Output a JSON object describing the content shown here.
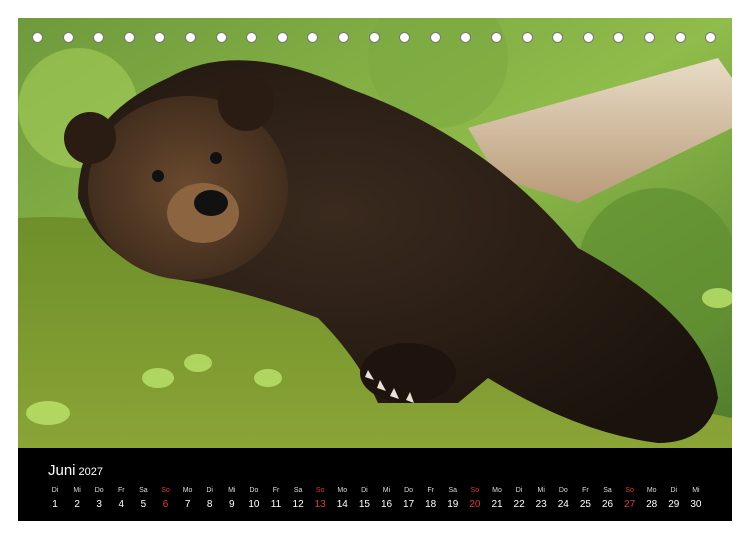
{
  "calendar": {
    "month": "Juni",
    "year": "2027",
    "colors": {
      "weekday": "#ffffff",
      "sunday": "#e23a2e",
      "strip": "#000000"
    },
    "days": [
      {
        "wd": "Di",
        "n": "1",
        "sun": false
      },
      {
        "wd": "Mi",
        "n": "2",
        "sun": false
      },
      {
        "wd": "Do",
        "n": "3",
        "sun": false
      },
      {
        "wd": "Fr",
        "n": "4",
        "sun": false
      },
      {
        "wd": "Sa",
        "n": "5",
        "sun": false
      },
      {
        "wd": "So",
        "n": "6",
        "sun": true
      },
      {
        "wd": "Mo",
        "n": "7",
        "sun": false
      },
      {
        "wd": "Di",
        "n": "8",
        "sun": false
      },
      {
        "wd": "Mi",
        "n": "9",
        "sun": false
      },
      {
        "wd": "Do",
        "n": "10",
        "sun": false
      },
      {
        "wd": "Fr",
        "n": "11",
        "sun": false
      },
      {
        "wd": "Sa",
        "n": "12",
        "sun": false
      },
      {
        "wd": "So",
        "n": "13",
        "sun": true
      },
      {
        "wd": "Mo",
        "n": "14",
        "sun": false
      },
      {
        "wd": "Di",
        "n": "15",
        "sun": false
      },
      {
        "wd": "Mi",
        "n": "16",
        "sun": false
      },
      {
        "wd": "Do",
        "n": "17",
        "sun": false
      },
      {
        "wd": "Fr",
        "n": "18",
        "sun": false
      },
      {
        "wd": "Sa",
        "n": "19",
        "sun": false
      },
      {
        "wd": "So",
        "n": "20",
        "sun": true
      },
      {
        "wd": "Mo",
        "n": "21",
        "sun": false
      },
      {
        "wd": "Di",
        "n": "22",
        "sun": false
      },
      {
        "wd": "Mi",
        "n": "23",
        "sun": false
      },
      {
        "wd": "Do",
        "n": "24",
        "sun": false
      },
      {
        "wd": "Fr",
        "n": "25",
        "sun": false
      },
      {
        "wd": "Sa",
        "n": "26",
        "sun": false
      },
      {
        "wd": "So",
        "n": "27",
        "sun": true
      },
      {
        "wd": "Mo",
        "n": "28",
        "sun": false
      },
      {
        "wd": "Di",
        "n": "29",
        "sun": false
      },
      {
        "wd": "Mi",
        "n": "30",
        "sun": false
      }
    ]
  }
}
